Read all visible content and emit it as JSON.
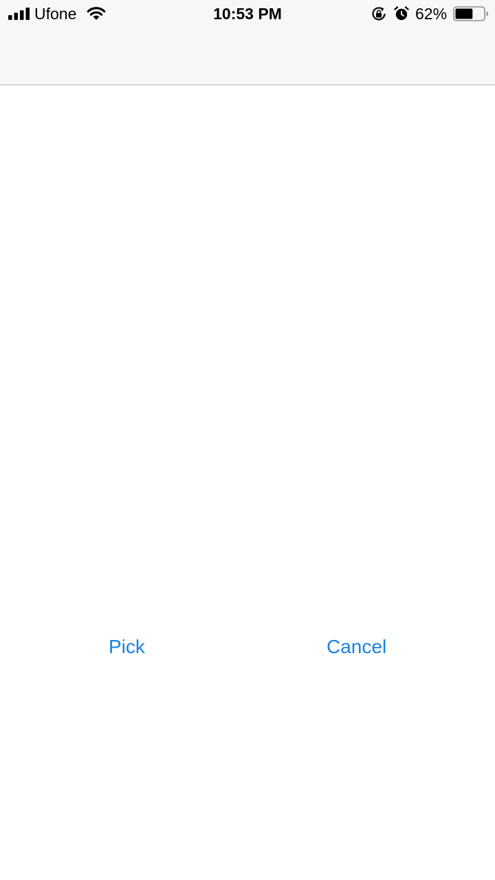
{
  "status_bar": {
    "carrier": "Ufone",
    "time": "10:53 PM",
    "battery_percent_label": "62%",
    "battery_level": 0.62,
    "signal_bars": 4,
    "icons": [
      "signal-icon",
      "wifi-icon",
      "rotation-lock-icon",
      "alarm-icon",
      "battery-icon"
    ]
  },
  "actions": {
    "pick_label": "Pick",
    "cancel_label": "Cancel"
  },
  "colors": {
    "accent": "#1a82e2",
    "nav_background": "#f7f7f7",
    "background": "#ffffff"
  }
}
